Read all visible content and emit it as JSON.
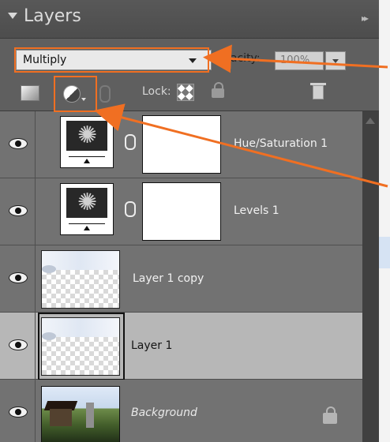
{
  "panel": {
    "title": "Layers"
  },
  "options": {
    "blend_mode": "Multiply",
    "opacity_label": "Opacity:",
    "opacity_value": "100%"
  },
  "toolbar": {
    "lock_label": "Lock:"
  },
  "layers": [
    {
      "name": "Hue/Saturation 1"
    },
    {
      "name": "Levels 1"
    },
    {
      "name": "Layer 1 copy"
    },
    {
      "name": "Layer 1"
    },
    {
      "name": "Background"
    }
  ],
  "colors": {
    "annotation": "#f06f22",
    "selected_row": "#b7b7b7"
  },
  "icons": [
    "collapse-triangle-icon",
    "panel-menu-icon",
    "new-layer-icon",
    "adjustment-layer-icon",
    "link-icon",
    "lock-transparent-icon",
    "lock-all-icon",
    "trash-icon",
    "eye-icon",
    "chain-link-icon",
    "lock-icon"
  ]
}
